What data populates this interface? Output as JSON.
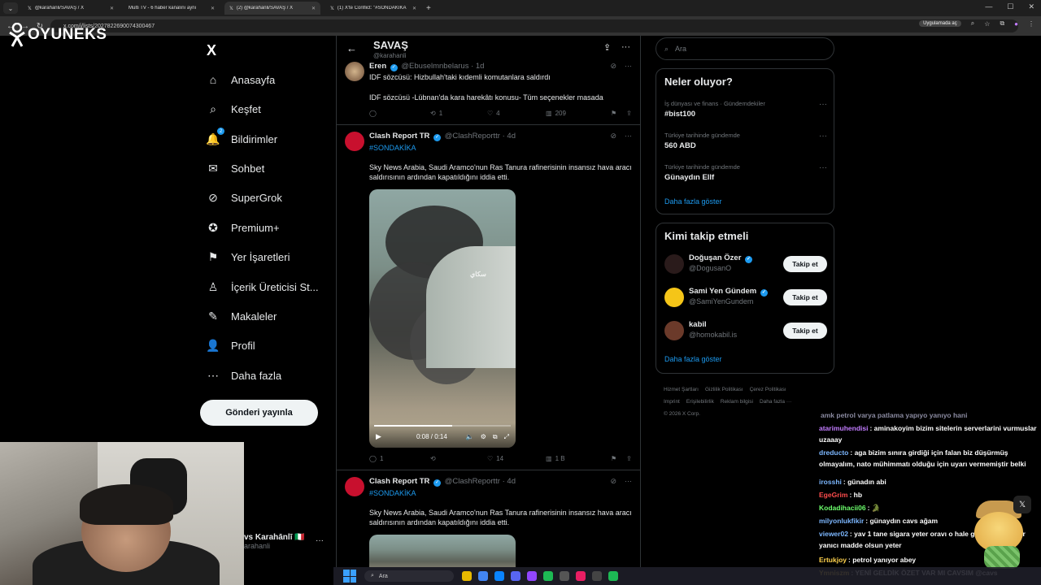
{
  "browser": {
    "tabs": [
      {
        "label": "@karahanli/SAVAŞ / X",
        "active": false
      },
      {
        "label": "Multi TV - 6 haber kanalını aynı",
        "active": false
      },
      {
        "label": "(2) @karahanli/SAVAŞ / X",
        "active": true
      },
      {
        "label": "(1) X'te Conflict: \"#SONDAKİKA",
        "active": false
      }
    ],
    "url": "x.com/i/lists/2027822690074300467",
    "app_chip": "Uygulamada aç"
  },
  "overlay_logo": "OYUNEKS",
  "sidebar": {
    "x_logo": "X",
    "items": [
      {
        "label": "Anasayfa",
        "icon": "home-icon",
        "glyph": "⌂"
      },
      {
        "label": "Keşfet",
        "icon": "search-icon",
        "glyph": "⌕"
      },
      {
        "label": "Bildirimler",
        "icon": "bell-icon",
        "glyph": "🔔",
        "badge": "2"
      },
      {
        "label": "Sohbet",
        "icon": "mail-icon",
        "glyph": "✉"
      },
      {
        "label": "SuperGrok",
        "icon": "grok-icon",
        "glyph": "⊘"
      },
      {
        "label": "Premium+",
        "icon": "premium-icon",
        "glyph": "✪"
      },
      {
        "label": "Yer İşaretleri",
        "icon": "bookmark-icon",
        "glyph": "⚑"
      },
      {
        "label": "İçerik Üreticisi St...",
        "icon": "creator-icon",
        "glyph": "♙"
      },
      {
        "label": "Makaleler",
        "icon": "article-icon",
        "glyph": "✎"
      },
      {
        "label": "Profil",
        "icon": "profile-icon",
        "glyph": "👤"
      },
      {
        "label": "Daha fazla",
        "icon": "more-icon",
        "glyph": "⋯"
      }
    ],
    "post_button": "Gönderi yayınla",
    "user_name": "vs Karahānlī 🇮🇹",
    "user_handle": "arahanli",
    "user_more": "···"
  },
  "feed": {
    "title": "SAVAŞ",
    "subtitle": "@karahanli",
    "tweets": [
      {
        "name": "Eren",
        "handle": "@Ebuselmnbelarus · 1d",
        "text1": "IDF sözcüsü: Hizbullah'taki kıdemli komutanlara saldırdı",
        "text2": "IDF sözcüsü -Lübnan'da kara harekâtı konusu- Tüm seçenekler masada",
        "replies": "",
        "reposts": "1",
        "likes": "4",
        "views": "209"
      },
      {
        "name": "Clash Report TR",
        "handle": "@ClashReporttr · 4d",
        "hashtag": "#SONDAKİKA",
        "text": "Sky News Arabia, Saudi Aramco'nun Ras Tanura rafinerisinin insansız hava aracı saldırısının ardından kapatıldığını iddia etti.",
        "video_time": "0:08 / 0:14",
        "video_progress": 0.57,
        "watermark": "سكاي",
        "replies": "1",
        "reposts": "",
        "likes": "14",
        "views": "1 B"
      },
      {
        "name": "Clash Report TR",
        "handle": "@ClashReporttr · 4d",
        "hashtag": "#SONDAKİKA",
        "text": "Sky News Arabia, Saudi Aramco'nun Ras Tanura rafinerisinin insansız hava aracı saldırısının ardından kapatıldığını iddia etti."
      }
    ]
  },
  "right": {
    "search_placeholder": "Ara",
    "trends_title": "Neler oluyor?",
    "trends": [
      {
        "context": "İş dünyası ve finans · Gündemdekiler",
        "topic": "#bist100"
      },
      {
        "context": "Türkiye tarihinde gündemde",
        "topic": "560 ABD"
      },
      {
        "context": "Türkiye tarihinde gündemde",
        "topic": "Günaydın Ellf"
      }
    ],
    "trends_more": "Daha fazla göster",
    "who_title": "Kimi takip etmeli",
    "who": [
      {
        "name": "Doğuşan Özer",
        "handle": "@DogusanO",
        "follow": "Takip et",
        "color": "#2a1b1b"
      },
      {
        "name": "Sami Yen Gündem",
        "handle": "@SamiYenGundem",
        "follow": "Takip et",
        "color": "#f5c518"
      },
      {
        "name": "kabil",
        "handle": "@homokabil.is",
        "follow": "Takip et",
        "color": "#6b3a2a"
      }
    ],
    "who_more": "Daha fazla göster",
    "footer_links": [
      "Hizmet Şartları",
      "Gizlilik Politikası",
      "Çerez Politikası",
      "Imprint",
      "Erişilebilirlik",
      "Reklam bilgisi",
      "Daha fazla ···"
    ],
    "copyright": "© 2026 X Corp."
  },
  "chat": [
    {
      "user": "",
      "msg": "amk petrol varya patlama yapıyo yanıyo hani",
      "color": "#8a8aa0"
    },
    {
      "user": "atarimuhendisi",
      "msg": ": aminakoyim bizim sitelerin serverlarini vurmuslar uzaaay",
      "color": "#c27cff"
    },
    {
      "user": "dreducto",
      "msg": ": aga bizim sınıra girdiği için falan biz düşürmüş olmayalım, nato mühimmatı olduğu için uyarı vermemiştir belki",
      "color": "#7cb7ff"
    },
    {
      "user": "irosshi",
      "msg": ": günadın abi",
      "color": "#7cb7ff"
    },
    {
      "user": "EgeGrim",
      "msg": ": hb",
      "color": "#ff4d4d"
    },
    {
      "user": "Kodadihacii06",
      "msg": ": 🐊",
      "color": "#6cff6c"
    },
    {
      "user": "milyonlukfikir",
      "msg": ": günaydın cavs ağam",
      "color": "#7cb7ff"
    },
    {
      "user": "viewer02",
      "msg": ": yav 1 tane sigara yeter oravı o hale getirmeye ne var yanıcı madde olsun yeter",
      "color": "#7cb7ff"
    },
    {
      "user": "Ertukjoy",
      "msg": ": petrol yanıyor abey",
      "color": "#ffd24d"
    },
    {
      "user": "Ymniszm",
      "msg": ": YENİ GELDİK ÖZET VAR MI CAVSIM @cavs",
      "color": "#ffd24d"
    }
  ],
  "taskbar": {
    "search": "Ara"
  }
}
